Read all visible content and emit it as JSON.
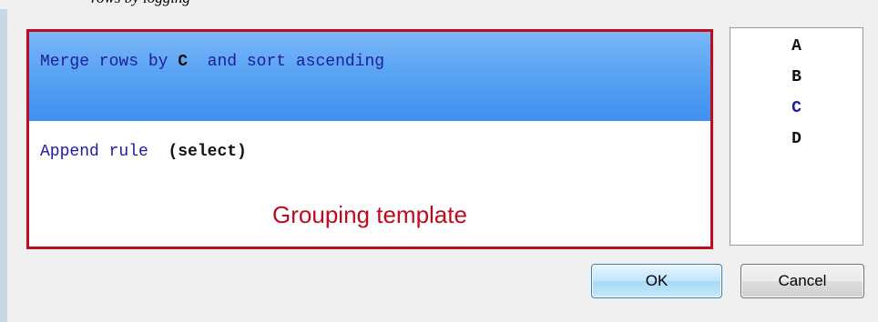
{
  "window": {
    "partial_title": "rows by logging"
  },
  "template": {
    "merge_rule": {
      "prefix": "Merge rows by ",
      "column": "C",
      "suffix": "  and sort ascending"
    },
    "append_rule": {
      "label": "Append rule ",
      "value": "(select)"
    },
    "caption": "Grouping template"
  },
  "column_list": {
    "items": [
      "A",
      "B",
      "C",
      "D"
    ],
    "selected": "C"
  },
  "buttons": {
    "ok": "OK",
    "cancel": "Cancel"
  },
  "colors": {
    "frame_red": "#c00a1d",
    "keyword_blue": "#1b1ca0",
    "highlight_blue": "#5aa4f4"
  }
}
